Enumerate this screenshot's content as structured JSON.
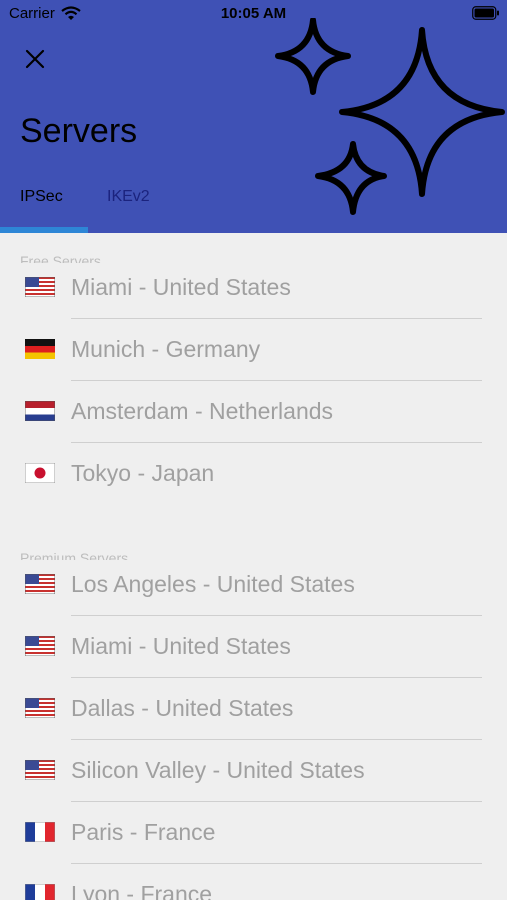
{
  "status_bar": {
    "carrier": "Carrier",
    "time": "10:05 AM"
  },
  "header": {
    "title": "Servers",
    "tabs": [
      {
        "label": "IPSec",
        "selected": true
      },
      {
        "label": "IKEv2",
        "selected": false
      }
    ],
    "icons": [
      "close-icon",
      "sparkles-icon"
    ]
  },
  "colors": {
    "header_bg": "#3f51b5",
    "tab_indicator": "#2e86d6",
    "list_bg": "#efefef"
  },
  "sections": [
    {
      "label": "Free Servers",
      "servers": [
        {
          "label": "Miami - United States",
          "flag": "us"
        },
        {
          "label": "Munich - Germany",
          "flag": "de"
        },
        {
          "label": "Amsterdam - Netherlands",
          "flag": "nl"
        },
        {
          "label": "Tokyo - Japan",
          "flag": "jp"
        }
      ]
    },
    {
      "label": "Premium Servers",
      "servers": [
        {
          "label": "Los Angeles - United States",
          "flag": "us"
        },
        {
          "label": "Miami - United States",
          "flag": "us"
        },
        {
          "label": "Dallas - United States",
          "flag": "us"
        },
        {
          "label": "Silicon Valley - United States",
          "flag": "us"
        },
        {
          "label": "Paris - France",
          "flag": "fr"
        },
        {
          "label": "Lyon - France",
          "flag": "fr"
        }
      ]
    }
  ]
}
